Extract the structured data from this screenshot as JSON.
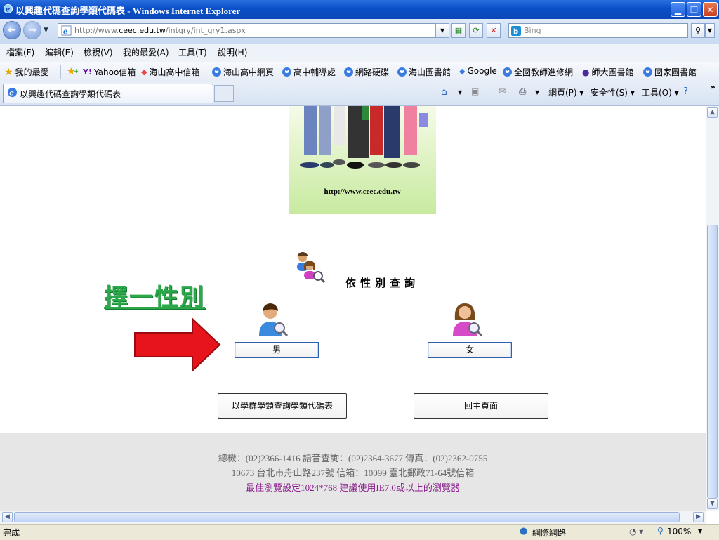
{
  "window": {
    "title": "以興趣代碼查詢學類代碼表 - Windows Internet Explorer",
    "minimize_label": "▁",
    "maximize_label": "❐",
    "close_label": "✕"
  },
  "address": {
    "url_prefix": "http://www.",
    "url_host": "ceec.edu.tw",
    "url_path": "/intqry/int_qry1.aspx",
    "search_placeholder": "Bing"
  },
  "menu": {
    "items": [
      "檔案(F)",
      "編輯(E)",
      "檢視(V)",
      "我的最愛(A)",
      "工具(T)",
      "說明(H)"
    ]
  },
  "favorites": {
    "label": "我的最愛",
    "items": [
      "Yahoo信箱",
      "海山高中信箱",
      "海山高中網頁",
      "高中輔導處",
      "網路硬碟",
      "海山圖書館",
      "Google",
      "全國教師進修網",
      "師大圖書館",
      "國家圖書館"
    ]
  },
  "tabs": {
    "active_label": "以興趣代碼查詢學類代碼表"
  },
  "commandbar": {
    "page_label": "網頁(P) ▾",
    "safety_label": "安全性(S) ▾",
    "tools_label": "工具(O) ▾",
    "more_label": "»"
  },
  "page": {
    "banner_url": "http://www.ceec.edu.tw",
    "query_title": "依性別查詢",
    "annotation": "擇一性別",
    "male_label": "男",
    "female_label": "女",
    "group_query_label": "以學群學類查詢學類代碼表",
    "home_label": "回主頁面",
    "footer_line1": "總機：(02)2366-1416 語音查詢：(02)2364-3677 傳真：(02)2362-0755",
    "footer_line2": "10673 台北市舟山路237號 信箱：10099 臺北郵政71-64號信箱",
    "footer_line3": "最佳瀏覽設定1024*768 建議使用IE7.0或以上的瀏覽器"
  },
  "status": {
    "text": "完成",
    "zone": "網際網路",
    "zoom": "100%"
  },
  "colors": {
    "annotation": "#2aa84a",
    "arrow": "#e8141b",
    "footer_highlight": "#8a1c8c"
  }
}
